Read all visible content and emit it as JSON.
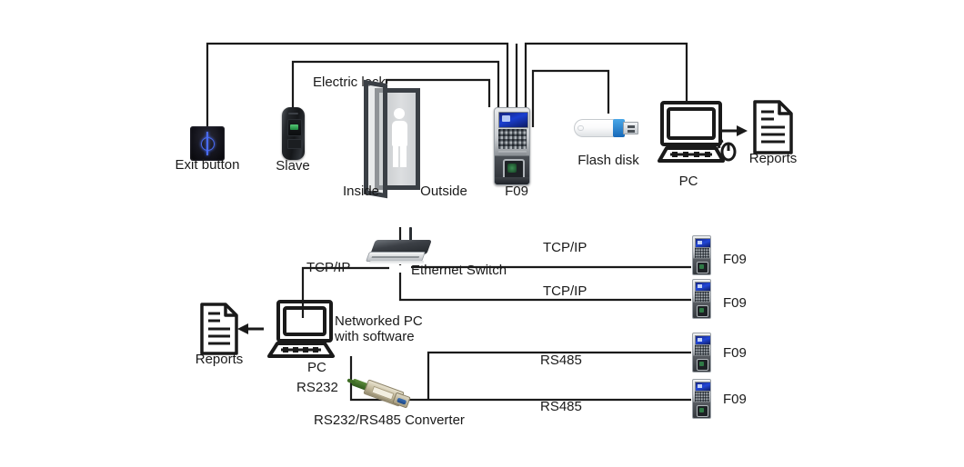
{
  "diagram": {
    "title": "Access control system connection diagram",
    "line_color": "#1a1a1a",
    "upper_section": {
      "nodes": [
        {
          "id": "exit-button",
          "label": "Exit button"
        },
        {
          "id": "slave",
          "label": "Slave"
        },
        {
          "id": "electric-lock",
          "label": "Electric lock"
        },
        {
          "id": "door-inside",
          "label": "Inside"
        },
        {
          "id": "door-outside",
          "label": "Outside"
        },
        {
          "id": "f09-main",
          "label": "F09"
        },
        {
          "id": "flash-disk",
          "label": "Flash disk"
        },
        {
          "id": "pc",
          "label": "PC"
        },
        {
          "id": "reports",
          "label": "Reports"
        }
      ]
    },
    "lower_section": {
      "nodes": [
        {
          "id": "ethernet-switch",
          "label": "Ethernet Switch"
        },
        {
          "id": "networked-pc",
          "label": "Networked PC\nwith software"
        },
        {
          "id": "networked-pc-port",
          "label": "PC"
        },
        {
          "id": "networked-pc-rs232",
          "label": "RS232"
        },
        {
          "id": "reports-lower",
          "label": "Reports"
        },
        {
          "id": "converter",
          "label": "RS232/RS485 Converter"
        }
      ],
      "links": [
        {
          "id": "link-switch-pc",
          "label": "TCP/IP",
          "protocol": "TCP/IP"
        },
        {
          "id": "link-switch-f09-1",
          "label": "TCP/IP",
          "protocol": "TCP/IP"
        },
        {
          "id": "link-switch-f09-2",
          "label": "TCP/IP",
          "protocol": "TCP/IP"
        },
        {
          "id": "link-conv-f09-3",
          "label": "RS485",
          "protocol": "RS485"
        },
        {
          "id": "link-conv-f09-4",
          "label": "RS485",
          "protocol": "RS485"
        }
      ],
      "f09_terminals": [
        {
          "id": "f09-net-1",
          "label": "F09"
        },
        {
          "id": "f09-net-2",
          "label": "F09"
        },
        {
          "id": "f09-net-3",
          "label": "F09"
        },
        {
          "id": "f09-net-4",
          "label": "F09"
        }
      ]
    }
  }
}
